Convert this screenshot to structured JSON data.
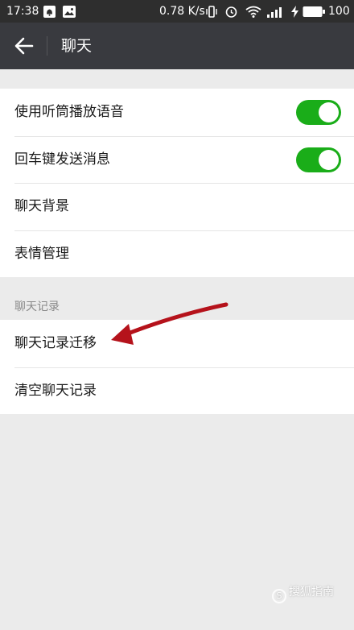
{
  "status_bar": {
    "time": "17:38",
    "net_speed": "0.78 K/s",
    "battery": "100"
  },
  "header": {
    "title": "聊天"
  },
  "settings": {
    "items": [
      {
        "label": "使用听筒播放语音",
        "toggle": true
      },
      {
        "label": "回车键发送消息",
        "toggle": true
      },
      {
        "label": "聊天背景"
      },
      {
        "label": "表情管理"
      }
    ]
  },
  "chat_history": {
    "section_label": "聊天记录",
    "items": [
      {
        "label": "聊天记录迁移"
      },
      {
        "label": "清空聊天记录"
      }
    ]
  },
  "watermark": "搜狐指南",
  "colors": {
    "status_bar": "#2e2e2e",
    "title_bar": "#393a3f",
    "toggle_on": "#1aad19",
    "page_background": "#ebebeb",
    "arrow": "#b5121b"
  }
}
